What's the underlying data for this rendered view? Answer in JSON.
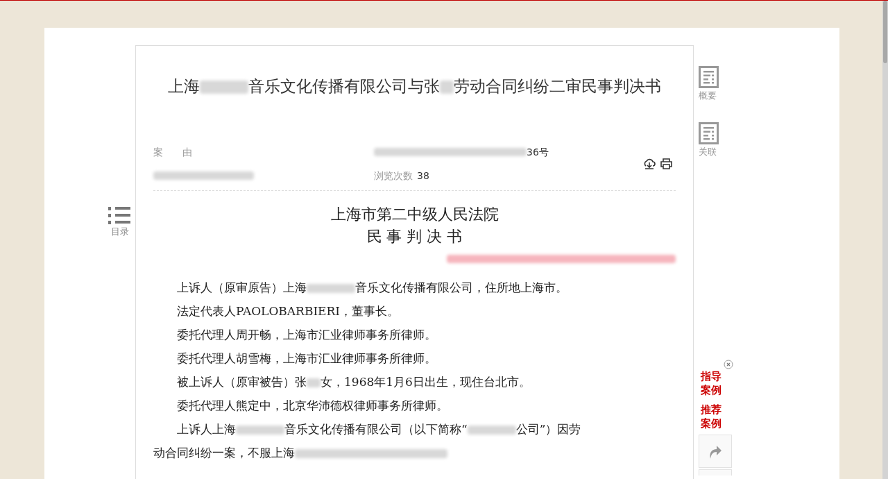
{
  "document": {
    "title": [
      {
        "kind": "text",
        "text": "上海"
      },
      {
        "kind": "blur_m"
      },
      {
        "kind": "text",
        "text": "音乐文化传播有限公司与张"
      },
      {
        "kind": "blur_xs"
      },
      {
        "kind": "text",
        "text": "劳动合同纠纷二审民事判决书"
      }
    ],
    "meta_left": [
      [
        {
          "kind": "label",
          "text": "案　　由"
        }
      ],
      [
        {
          "kind": "blur_l"
        }
      ]
    ],
    "meta_right": [
      [
        {
          "kind": "blur_xl"
        },
        {
          "kind": "text",
          "text": "36号"
        }
      ],
      [
        {
          "kind": "label",
          "text": "浏览次数"
        },
        {
          "kind": "text",
          "text": "38"
        }
      ]
    ],
    "court": "上海市第二中级人民法院",
    "doc_type": "民 事 判 决 书",
    "date_line": [
      {
        "kind": "blur_red"
      }
    ],
    "paragraphs": [
      [
        {
          "kind": "text",
          "text": "上诉人（原审原告）上海"
        },
        {
          "kind": "blur_m"
        },
        {
          "kind": "text",
          "text": "音乐文化传播有限公司，住所地上海市。"
        }
      ],
      [
        {
          "kind": "text",
          "text": "法定代表人PAOLOBARBIERI，董事长。"
        }
      ],
      [
        {
          "kind": "text",
          "text": "委托代理人周开畅，上海市汇业律师事务所律师。"
        }
      ],
      [
        {
          "kind": "text",
          "text": "委托代理人胡雪梅，上海市汇业律师事务所律师。"
        }
      ],
      [
        {
          "kind": "text",
          "text": "被上诉人（原审被告）张"
        },
        {
          "kind": "blur_xs"
        },
        {
          "kind": "text",
          "text": "女，1968年1月6日出生，现住台北市。"
        }
      ],
      [
        {
          "kind": "text",
          "text": "委托代理人熊定中，北京华沛德权律师事务所律师。"
        }
      ],
      [
        {
          "kind": "text",
          "text": "上诉人上海"
        },
        {
          "kind": "blur_m"
        },
        {
          "kind": "text",
          "text": "音乐文化传播有限公司（以下简称“"
        },
        {
          "kind": "blur_m"
        },
        {
          "kind": "text",
          "text": "公司”）因劳"
        },
        {
          "kind": "text",
          "text": "动合同纠纷一案，不服上海"
        },
        {
          "kind": "blur_xl"
        }
      ]
    ]
  },
  "left_tools": [
    {
      "label": "目录"
    }
  ],
  "right_tools": [
    {
      "label": "概要"
    },
    {
      "label": "关联"
    }
  ],
  "case_links": [
    {
      "label": "指导案例"
    },
    {
      "label": "推荐案例"
    }
  ]
}
